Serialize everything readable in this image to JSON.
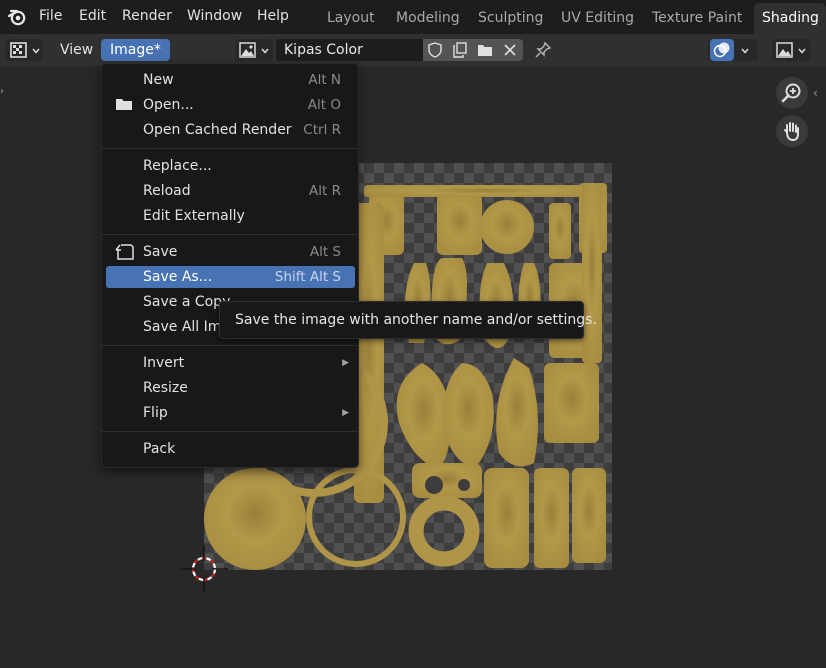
{
  "topbar": {
    "menus": [
      "File",
      "Edit",
      "Render",
      "Window",
      "Help"
    ],
    "workspaces": [
      "Layout",
      "Modeling",
      "Sculpting",
      "UV Editing",
      "Texture Paint",
      "Shading"
    ],
    "active_workspace": "Shading"
  },
  "header": {
    "view_label": "View",
    "image_menu_label": "Image*",
    "image_name": "Kipas Color"
  },
  "menu": {
    "items": [
      {
        "label": "New",
        "shortcut": "Alt N"
      },
      {
        "label": "Open...",
        "shortcut": "Alt O",
        "icon": "folder-icon"
      },
      {
        "label": "Open Cached Render",
        "shortcut": "Ctrl R"
      },
      {
        "label": "Replace...",
        "shortcut": ""
      },
      {
        "label": "Reload",
        "shortcut": "Alt R"
      },
      {
        "label": "Edit Externally",
        "shortcut": ""
      },
      {
        "label": "Save",
        "shortcut": "Alt S",
        "icon": "save-file-icon"
      },
      {
        "label": "Save As...",
        "shortcut": "Shift Alt S",
        "highlighted": true
      },
      {
        "label": "Save a Copy",
        "shortcut": ""
      },
      {
        "label": "Save All Images",
        "shortcut": ""
      },
      {
        "label": "Invert",
        "shortcut": "",
        "submenu": true
      },
      {
        "label": "Resize",
        "shortcut": ""
      },
      {
        "label": "Flip",
        "shortcut": "",
        "submenu": true
      },
      {
        "label": "Pack",
        "shortcut": ""
      }
    ]
  },
  "tooltip": {
    "text": "Save the image with another name and/or settings."
  },
  "colors": {
    "accent": "#4772b3",
    "texture": "#b09548"
  }
}
